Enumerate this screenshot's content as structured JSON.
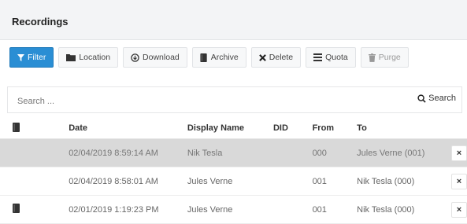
{
  "panel": {
    "title": "Recordings"
  },
  "toolbar": {
    "filter": "Filter",
    "location": "Location",
    "download": "Download",
    "archive": "Archive",
    "delete": "Delete",
    "quota": "Quota",
    "purge": "Purge"
  },
  "search": {
    "placeholder": "Search ...",
    "button": "Search"
  },
  "table": {
    "headers": {
      "date": "Date",
      "display_name": "Display Name",
      "did": "DID",
      "from": "From",
      "to": "To"
    },
    "rows": [
      {
        "archived": false,
        "date": "02/04/2019 8:59:14 AM",
        "display_name": "Nik Tesla",
        "did": "",
        "from": "000",
        "to": "Jules Verne (001)",
        "selected": true,
        "delete": "×"
      },
      {
        "archived": false,
        "date": "02/04/2019 8:58:01 AM",
        "display_name": "Jules Verne",
        "did": "",
        "from": "001",
        "to": "Nik Tesla (000)",
        "selected": false,
        "delete": "×"
      },
      {
        "archived": true,
        "date": "02/01/2019 1:19:23 PM",
        "display_name": "Jules Verne",
        "did": "",
        "from": "001",
        "to": "Nik Tesla (000)",
        "selected": false,
        "delete": "×"
      }
    ]
  },
  "colors": {
    "primary": "#2a8ed4",
    "selected_row": "#d9d9d9",
    "header_bg": "#f3f4f6"
  }
}
